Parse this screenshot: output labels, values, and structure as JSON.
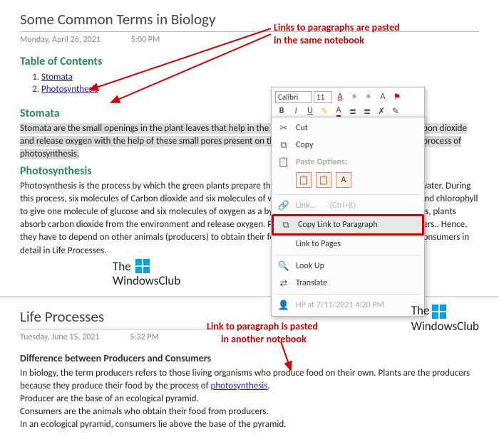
{
  "page1": {
    "title": "Some Common Terms in Biology",
    "date": "Monday, April 26, 2021",
    "time": "5:00 PM",
    "annotation1_line1": "Links to paragraphs are pasted",
    "annotation1_line2": "in the same notebook",
    "toc_heading": "Table of Contents",
    "toc": [
      "Stomata",
      "Photosynthesis"
    ],
    "stomata_heading": "Stomata",
    "stomata_body": "Stomata are the small openings in the plant leaves that help in the exchange of gases. The plants take in carbon dioxide and release oxygen with the help of these small pores present on the leaves. Stomata also takes part in the process of photosynthesis.",
    "photo_heading": "Photosynthesis",
    "photo_body_pre": "Photosynthesis is the process by which the green plants prepare their food in the presence of sunlight and water. During this process, six molecules of Carbon dioxide and six molecules of water combine in the presence of water and chlorophyll to give one molecule of glucose and six molecules of oxygen as a byproduct. In the process of photosynthesis, plants absorb carbon dioxide from the environment and release oxygen. Photosynthesis does not occur in consumers.. Hence, they have to depend on other animals (producers) to obtain their food. You can read about producers and consumers in detail in Life Processes.",
    "watermark_line1": "The",
    "watermark_line2": "WindowsClub"
  },
  "toolbar": {
    "font": "Calibri",
    "size": "11"
  },
  "menu": {
    "cut": "Cut",
    "copy": "Copy",
    "paste_label": "Paste Options:",
    "link": "Link...",
    "link_shortcut": "(Ctrl+K)",
    "copy_link_para": "Copy Link to Paragraph",
    "link_pages": "Link to Pages",
    "lookup": "Look Up",
    "translate": "Translate",
    "hp_info": "HP at 7/11/2021 4:20 PM"
  },
  "page2": {
    "title": "Life Processes",
    "date": "Tuesday, June 15, 2021",
    "time": "5:32 PM",
    "annotation2_line1": "Link to paragraph is pasted",
    "annotation2_line2": "in another notebook",
    "heading": "Difference between Producers and Consumers",
    "body1_pre": "In biology, the term producers refers to those living organisms who produce food on their own. Plants are the producers because they produce their food by the process of ",
    "body1_link": "photosynthesis",
    "body1_post": ".",
    "body2": "Producer are the base of an ecological pyramid.",
    "body3": "Consumers are the animals who obtain their food from producers.",
    "body4": "In an ecological pyramid, consumers lie above the base of the pyramid."
  }
}
